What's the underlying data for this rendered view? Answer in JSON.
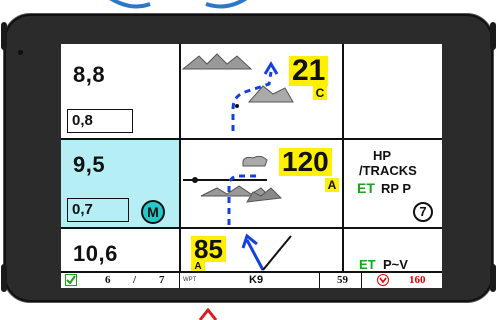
{
  "left_panel": {
    "top_value": "8,8",
    "top_sub": "0,8",
    "mid_value": "9,5",
    "mid_sub": "0,7",
    "mid_badge": "M",
    "bottom_value": "10,6"
  },
  "center_panel": {
    "top_number": "21",
    "top_tag": "C",
    "mid_number": "120",
    "mid_tag": "A",
    "bottom_number": "85",
    "bottom_tag": "A"
  },
  "right_panel": {
    "line1": "HP",
    "line2": "/TRACKS",
    "et": "ET",
    "rpp": "RP P",
    "circle_number": "7",
    "bottom_et": "ET",
    "bottom_rest": "P~V"
  },
  "status_bar": {
    "count_current": "6",
    "count_slash": "/",
    "count_total": "7",
    "wpt_label": "WPT",
    "waypoint_name": "K9",
    "value_1": "59",
    "value_2": "160"
  },
  "colors": {
    "cyan_cell": "#b6eef6",
    "highlight": "#ffef00",
    "route_blue": "#1540e0",
    "et_green": "#1aa51a",
    "status_red": "#e00000"
  }
}
